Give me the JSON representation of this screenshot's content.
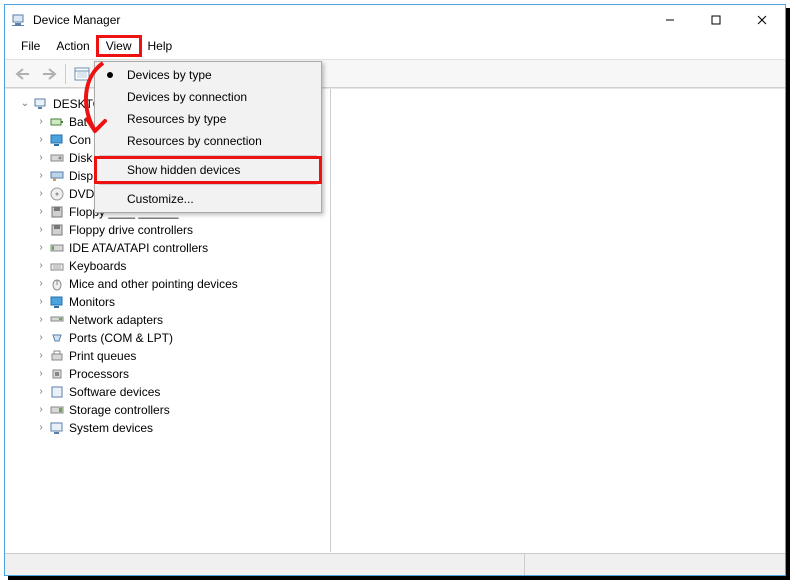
{
  "title": "Device Manager",
  "menubar": {
    "file": "File",
    "action": "Action",
    "view": "View",
    "help": "Help"
  },
  "view_menu": {
    "by_type": "Devices by type",
    "by_connection": "Devices by connection",
    "res_by_type": "Resources by type",
    "res_by_conn": "Resources by connection",
    "show_hidden": "Show hidden devices",
    "customize": "Customize..."
  },
  "tree": {
    "root": "DESKTO",
    "items": [
      "Bat",
      "Con",
      "Disk",
      "Disp",
      "DVD",
      "Floppy ____ ______",
      "Floppy drive controllers",
      "IDE ATA/ATAPI controllers",
      "Keyboards",
      "Mice and other pointing devices",
      "Monitors",
      "Network adapters",
      "Ports (COM & LPT)",
      "Print queues",
      "Processors",
      "Software devices",
      "Storage controllers",
      "System devices"
    ]
  },
  "annotations": {
    "highlighted_menu": "View",
    "highlighted_dropdown_item": "Show hidden devices"
  }
}
